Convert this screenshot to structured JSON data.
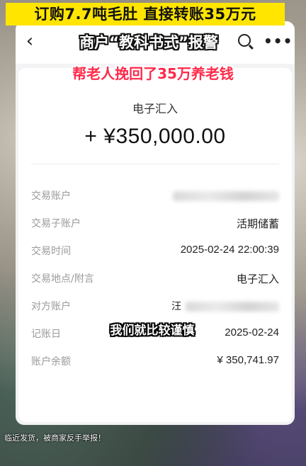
{
  "overlay": {
    "top_banner": "订购7.7吨毛肚 直接转账35万元",
    "headline": "商户“教科书式”报警",
    "subhead": "帮老人挽回了35万养老钱",
    "subtitle": "我们就比较谨慎",
    "bottom_caption": "临近发货，被商家反手举报！"
  },
  "nav": {
    "back_icon": "chevron-left-icon",
    "search_icon": "search-icon",
    "more_icon": "more-dots-icon",
    "more_label": "•••"
  },
  "transaction": {
    "type": "电子汇入",
    "amount": "+ ¥350,000.00",
    "rows": [
      {
        "label": "交易账户",
        "value": ""
      },
      {
        "label": "交易子账户",
        "value": "活期储蓄"
      },
      {
        "label": "交易时间",
        "value": "2025-02-24 22:00:39"
      },
      {
        "label": "交易地点/附言",
        "value": "电子汇入"
      },
      {
        "label": "对方账户",
        "value": "汪"
      },
      {
        "label": "记账日",
        "value": "2025-02-24"
      },
      {
        "label": "账户余额",
        "value": "¥ 350,741.97"
      }
    ]
  },
  "colors": {
    "banner": "#ffe500",
    "subhead": "#ff2a4a"
  }
}
